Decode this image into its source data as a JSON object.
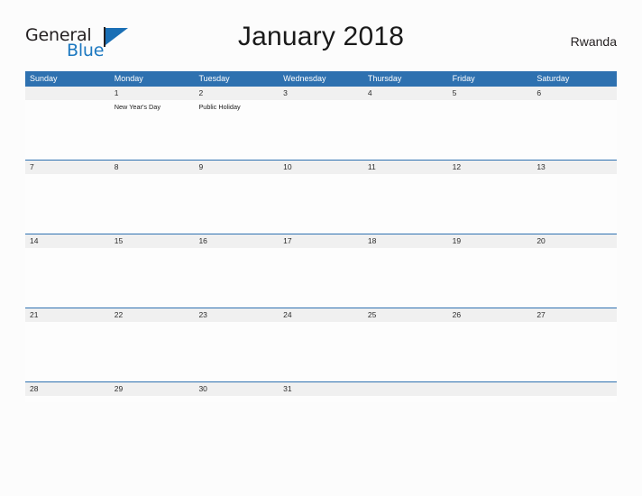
{
  "logo": {
    "word_top": "General",
    "word_bottom": "Blue",
    "flag_color": "#1a6fb5",
    "blue_color": "#1c78c0"
  },
  "header": {
    "title": "January 2018",
    "region": "Rwanda"
  },
  "theme": {
    "header_blue": "#2e71b0",
    "date_band_gray": "#f0f0f0",
    "page_background": "#fcfcfc"
  },
  "calendar": {
    "weekdays": [
      "Sunday",
      "Monday",
      "Tuesday",
      "Wednesday",
      "Thursday",
      "Friday",
      "Saturday"
    ],
    "weeks": [
      {
        "days": [
          {
            "date": "",
            "events": []
          },
          {
            "date": "1",
            "events": [
              "New Year's Day"
            ]
          },
          {
            "date": "2",
            "events": [
              "Public Holiday"
            ]
          },
          {
            "date": "3",
            "events": []
          },
          {
            "date": "4",
            "events": []
          },
          {
            "date": "5",
            "events": []
          },
          {
            "date": "6",
            "events": []
          }
        ]
      },
      {
        "days": [
          {
            "date": "7",
            "events": []
          },
          {
            "date": "8",
            "events": []
          },
          {
            "date": "9",
            "events": []
          },
          {
            "date": "10",
            "events": []
          },
          {
            "date": "11",
            "events": []
          },
          {
            "date": "12",
            "events": []
          },
          {
            "date": "13",
            "events": []
          }
        ]
      },
      {
        "days": [
          {
            "date": "14",
            "events": []
          },
          {
            "date": "15",
            "events": []
          },
          {
            "date": "16",
            "events": []
          },
          {
            "date": "17",
            "events": []
          },
          {
            "date": "18",
            "events": []
          },
          {
            "date": "19",
            "events": []
          },
          {
            "date": "20",
            "events": []
          }
        ]
      },
      {
        "days": [
          {
            "date": "21",
            "events": []
          },
          {
            "date": "22",
            "events": []
          },
          {
            "date": "23",
            "events": []
          },
          {
            "date": "24",
            "events": []
          },
          {
            "date": "25",
            "events": []
          },
          {
            "date": "26",
            "events": []
          },
          {
            "date": "27",
            "events": []
          }
        ]
      },
      {
        "last": true,
        "days": [
          {
            "date": "28",
            "events": []
          },
          {
            "date": "29",
            "events": []
          },
          {
            "date": "30",
            "events": []
          },
          {
            "date": "31",
            "events": []
          },
          {
            "date": "",
            "events": []
          },
          {
            "date": "",
            "events": []
          },
          {
            "date": "",
            "events": []
          }
        ]
      }
    ]
  }
}
